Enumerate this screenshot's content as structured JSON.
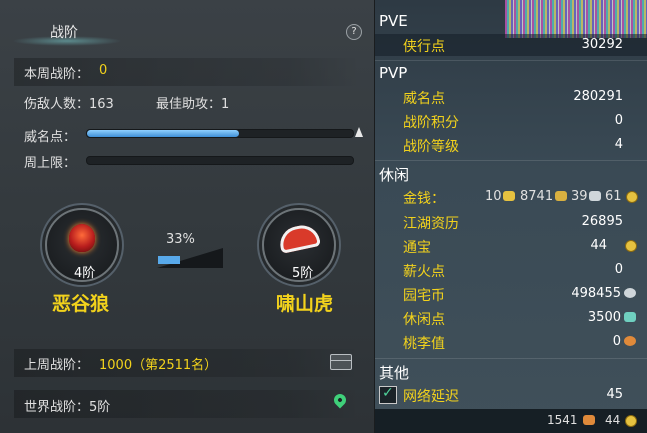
{
  "left": {
    "title": "战阶",
    "help": "?",
    "week_rank_label": "本周战阶：",
    "week_rank_value": "0",
    "injured_label": "伤敌人数：163",
    "assist_label": "最佳助攻：1",
    "prestige_label": "威名点：",
    "prestige_fill": 0.57,
    "week_cap_label": "周上限：",
    "week_cap_fill": 0,
    "current": {
      "level": "4阶",
      "name": "恶谷狼"
    },
    "next": {
      "level": "5阶",
      "name": "啸山虎"
    },
    "progress_pct": "33%",
    "progress_fill": 0.33,
    "last_week_label": "上周战阶：",
    "last_week_value": "1000（第2511名）",
    "world_label": "世界战阶：5阶"
  },
  "right": {
    "pve_title": "PVE",
    "pve_rows": [
      {
        "label": "侠行点",
        "value": "30292"
      }
    ],
    "pvp_title": "PVP",
    "pvp_rows": [
      {
        "label": "威名点",
        "value": "280291"
      },
      {
        "label": "战阶积分",
        "value": "0"
      },
      {
        "label": "战阶等级",
        "value": "4"
      }
    ],
    "leisure_title": "休闲",
    "money_label": "金钱：",
    "money_parts": [
      "10",
      "8741",
      "39",
      "61"
    ],
    "leisure_rows": [
      {
        "label": "江湖资历",
        "value": "26895"
      },
      {
        "label": "通宝",
        "value": "44"
      },
      {
        "label": "薪火点",
        "value": "0"
      },
      {
        "label": "园宅币",
        "value": "498455"
      },
      {
        "label": "休闲点",
        "value": "3500"
      },
      {
        "label": "桃李值",
        "value": "0"
      }
    ],
    "other_title": "其他",
    "latency_label": "网络延迟",
    "latency_value": "45",
    "bottom_left": "1541",
    "bottom_right": "44"
  }
}
